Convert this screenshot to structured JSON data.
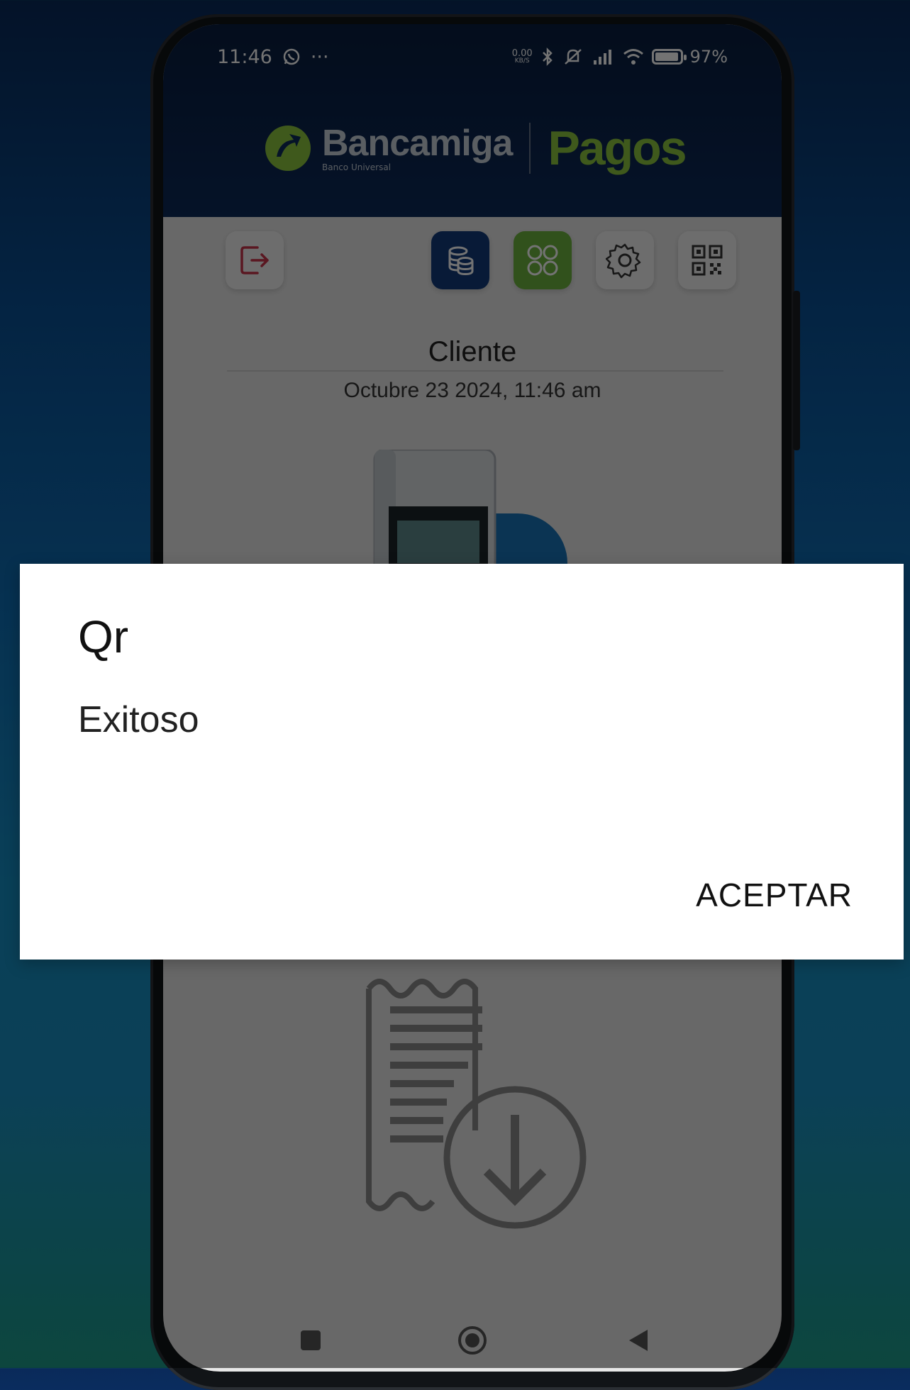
{
  "status_bar": {
    "time": "11:46",
    "more": "···",
    "net_speed": "0.00",
    "net_unit": "KB/S",
    "battery": "97%"
  },
  "brand": {
    "name": "Bancamiga",
    "subtitle": "Banco Universal",
    "product": "Pagos"
  },
  "toolbar": {
    "icons": [
      "logout-icon",
      "database-icon",
      "grid-icon",
      "settings-icon",
      "qr-code-icon"
    ]
  },
  "screen": {
    "title": "Cliente",
    "datetime": "Octubre 23 2024, 11:46 am"
  },
  "dialog": {
    "title": "Qr",
    "message": "Exitoso",
    "button_label": "ACEPTAR"
  },
  "colors": {
    "header_bg": "#0d2a59",
    "brand_green": "#8dc63f",
    "blue_button": "#123b7a",
    "green_button": "#6db33f",
    "logout_red": "#c8344b"
  }
}
